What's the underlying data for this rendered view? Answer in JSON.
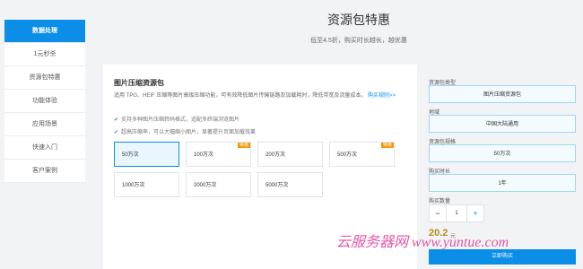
{
  "sidebar": {
    "items": [
      {
        "label": "数据处理"
      },
      {
        "label": "1元秒杀"
      },
      {
        "label": "资源包特惠"
      },
      {
        "label": "功能体验"
      },
      {
        "label": "应用场景"
      },
      {
        "label": "快速入门"
      },
      {
        "label": "客户案例"
      }
    ],
    "active_index": 0
  },
  "header": {
    "title": "资源包特惠",
    "subtitle": "低至4.5折，购买时长越长，越优惠"
  },
  "card": {
    "title": "图片压缩资源包",
    "description": "适用 TPG、HEIF 压缩等图片高级压缩功能，可有效降低图片传输链路及加载耗时，降低带宽及流量成本。",
    "more_label": "购买规则>>",
    "features": [
      "支持多种图片压缩转码格式，适配多终端浏览图片",
      "超高压缩率，可以大幅缩小图片，显著提升页面加载效果"
    ],
    "options": [
      {
        "label": "50万次",
        "badge": "",
        "selected": true
      },
      {
        "label": "100万次",
        "badge": "特惠",
        "selected": false
      },
      {
        "label": "200万次",
        "badge": "",
        "selected": false
      },
      {
        "label": "500万次",
        "badge": "特惠",
        "selected": false
      },
      {
        "label": "1000万次",
        "badge": "",
        "selected": false
      },
      {
        "label": "2000万次",
        "badge": "",
        "selected": false
      },
      {
        "label": "5000万次",
        "badge": "",
        "selected": false
      }
    ]
  },
  "form": {
    "type_label": "资源包类型",
    "type_value": "图片压缩资源包",
    "region_label": "地域",
    "region_value": "中国大陆通用",
    "spec_label": "资源包规格",
    "spec_value": "50万次",
    "duration_label": "购买时长",
    "duration_value": "1年",
    "quantity_label": "购买数量",
    "quantity_minus": "−",
    "quantity_value": "1",
    "quantity_plus": "+",
    "price": "20.2",
    "price_unit": "元",
    "buy_label": "立即购买"
  },
  "watermark": "云服务器网 www.yuntue.com",
  "colors": {
    "accent": "#0a8ee8",
    "badge": "#f39800",
    "price": "#b38b1d",
    "watermark": "#e03a9a"
  }
}
